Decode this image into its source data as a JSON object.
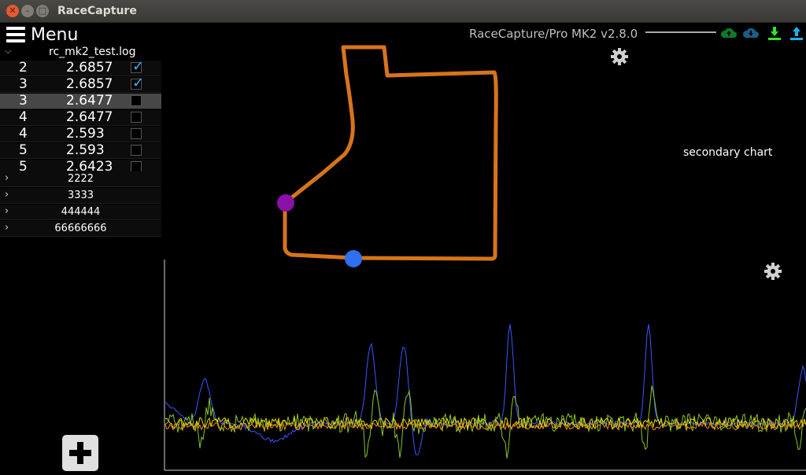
{
  "window": {
    "title": "RaceCapture"
  },
  "menu": {
    "label": "Menu"
  },
  "session": {
    "name": "rc_mk2_test.log"
  },
  "laps": [
    {
      "lap": "2",
      "time": "2.6857",
      "checked": true
    },
    {
      "lap": "3",
      "time": "2.6857",
      "checked": true
    },
    {
      "lap": "3",
      "time": "2.6477",
      "checked": false
    },
    {
      "lap": "4",
      "time": "2.6477",
      "checked": false
    },
    {
      "lap": "4",
      "time": "2.593",
      "checked": false
    },
    {
      "lap": "5",
      "time": "2.593",
      "checked": false
    },
    {
      "lap": "5",
      "time": "2.6423",
      "checked": false
    }
  ],
  "other_sessions": [
    "2222",
    "3333",
    "444444",
    "66666666"
  ],
  "device": {
    "label": "RaceCapture/Pro MK2 v2.8.0"
  },
  "toolbar_icons": [
    "cloud-upload-icon",
    "cloud-download-icon",
    "download-icon",
    "upload-icon"
  ],
  "secondary_chart": {
    "label": "secondary chart"
  },
  "colors": {
    "track": "#d8741a",
    "marker_a": "#8a10a8",
    "marker_b": "#2f6ff2",
    "series_blue": "#3a56ff",
    "series_yellow": "#e8d800",
    "series_green": "#88c62a",
    "series_orange": "#f09020",
    "check": "#3ab4ff"
  }
}
